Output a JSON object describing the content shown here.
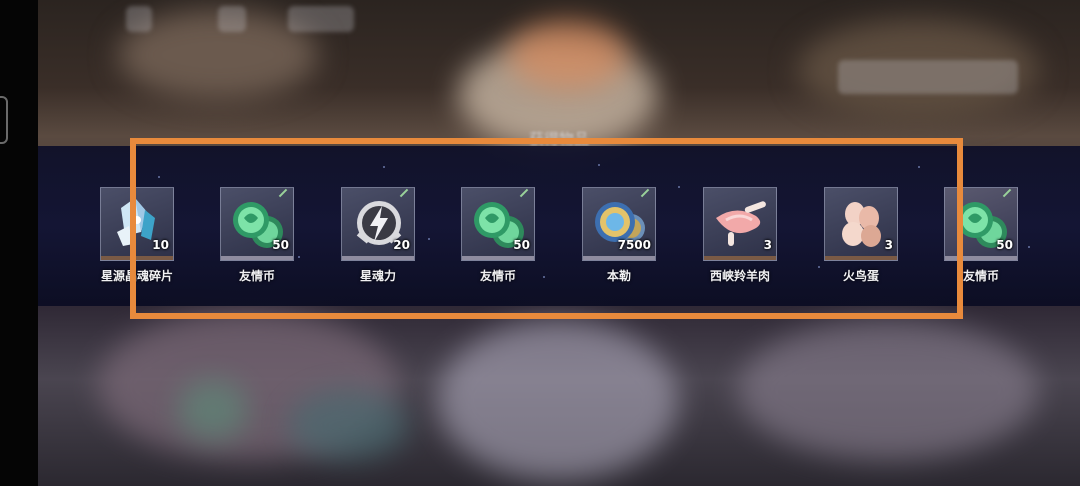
{
  "dialog": {
    "title": "获得物品"
  },
  "items": [
    {
      "name": "星源晶魂碎片",
      "qty": "10",
      "icon": "crystal-shard-icon"
    },
    {
      "name": "友情币",
      "qty": "50",
      "icon": "friendship-coin-icon"
    },
    {
      "name": "星魂力",
      "qty": "20",
      "icon": "star-soul-power-icon"
    },
    {
      "name": "友情币",
      "qty": "50",
      "icon": "friendship-coin-icon"
    },
    {
      "name": "本勒",
      "qty": "7500",
      "icon": "gold-coin-icon"
    },
    {
      "name": "西峡羚羊肉",
      "qty": "3",
      "icon": "antelope-meat-icon"
    },
    {
      "name": "火鸟蛋",
      "qty": "3",
      "icon": "firebird-egg-icon"
    },
    {
      "name": "友情币",
      "qty": "50",
      "icon": "friendship-coin-icon"
    }
  ],
  "colors": {
    "highlight": "#e88a3c",
    "band": "#12143a"
  }
}
